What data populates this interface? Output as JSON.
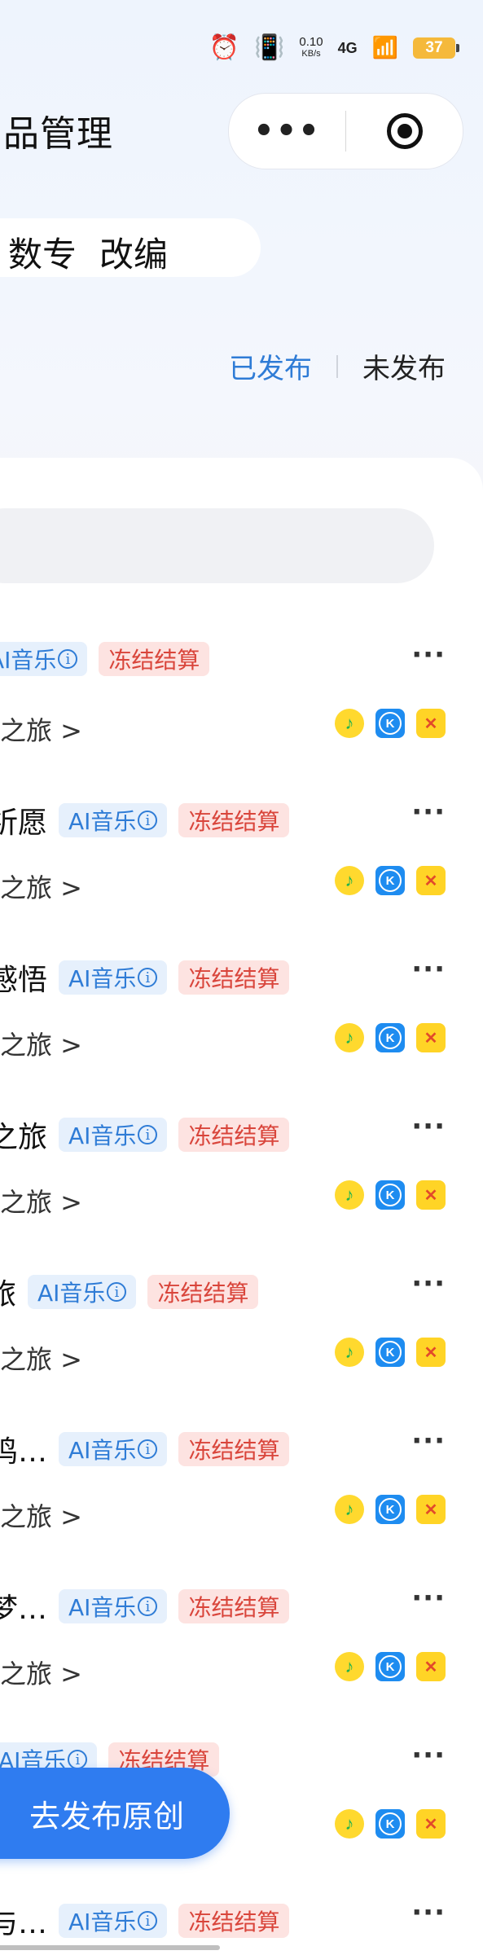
{
  "status_bar": {
    "speed_value": "0.10",
    "speed_unit": "KB/s",
    "network": "4G",
    "battery": "37"
  },
  "header": {
    "title": "品管理"
  },
  "category_tabs": [
    "数专",
    "改编"
  ],
  "publish_tabs": [
    "已发布",
    "未发布"
  ],
  "tags": {
    "ai": "AI音乐",
    "frozen": "冻结结算"
  },
  "items": [
    {
      "title": "",
      "subtitle": "之旅 >"
    },
    {
      "title": "祈愿",
      "subtitle": "之旅 >"
    },
    {
      "title": "感悟",
      "subtitle": "之旅 >"
    },
    {
      "title": "之旅",
      "subtitle": "之旅 >"
    },
    {
      "title": "旅",
      "subtitle": "之旅 >"
    },
    {
      "title": "鸣…",
      "subtitle": "之旅 >"
    },
    {
      "title": "梦…",
      "subtitle": "之旅 >"
    },
    {
      "title": "",
      "subtitle": ""
    },
    {
      "title": "与…",
      "subtitle": ""
    }
  ],
  "fab_label": "去发布原创",
  "icons": {
    "more": "more-icon",
    "close": "close-icon",
    "platform_1": "qq-music-icon",
    "platform_2": "kugou-icon",
    "platform_3": "kuwo-icon"
  }
}
